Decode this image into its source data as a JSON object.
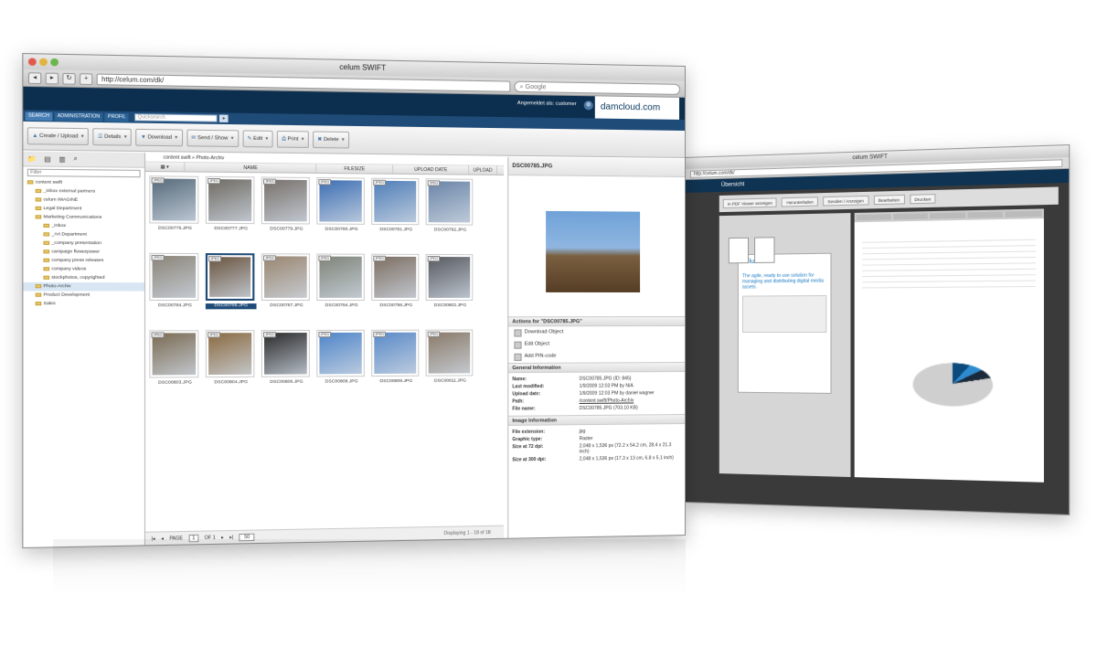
{
  "second_window": {
    "title": "celum SWIFT",
    "url": "http://celum.com/dk/",
    "header": "Übersicht",
    "toolbar": [
      "In PDF Viewer anzeigen",
      "Herunterladen",
      "Senden / Anzeigen",
      "Bearbeiten",
      "Drucken"
    ],
    "brand": "celum.swift",
    "headline": "The agile, ready to use solution for managing and distributing digital media assets."
  },
  "window": {
    "title": "celum SWIFT",
    "url": "http://celum.com/dk/",
    "search_placeholder": "Google"
  },
  "app": {
    "customer": "Angemeldet als: customer",
    "logo": "damcloud.com",
    "nav": [
      "SEARCH",
      "ADMINISTRATION",
      "PROFIL"
    ],
    "quick_search_placeholder": "Quicksearch"
  },
  "toolbar": {
    "create": "Create / Upload",
    "details": "Details",
    "download": "Download",
    "send": "Send / Show",
    "edit": "Edit",
    "print": "Print",
    "delete": "Delete"
  },
  "tree": {
    "filter_placeholder": "Filter",
    "nodes": [
      {
        "label": "content swift",
        "level": 0
      },
      {
        "label": "_inbox external partners",
        "level": 1
      },
      {
        "label": "celum IMAGINE",
        "level": 1
      },
      {
        "label": "Legal Department",
        "level": 1
      },
      {
        "label": "Marketing Communications",
        "level": 1
      },
      {
        "label": "_Inbox",
        "level": 2
      },
      {
        "label": "_Art Department",
        "level": 2
      },
      {
        "label": "_company presentation",
        "level": 2
      },
      {
        "label": "campaign flowerpower",
        "level": 2
      },
      {
        "label": "company press releases",
        "level": 2
      },
      {
        "label": "company videos",
        "level": 2
      },
      {
        "label": "stockphotos, copyrighted",
        "level": 2
      },
      {
        "label": "Photo-Archiv",
        "level": 1,
        "selected": true
      },
      {
        "label": "Product Development",
        "level": 1
      },
      {
        "label": "Sales",
        "level": 1
      }
    ]
  },
  "grid": {
    "breadcrumb": [
      "content swift",
      "Photo-Archiv"
    ],
    "columns": [
      "NAME",
      "FILESIZE",
      "UPLOAD DATE",
      "UPLOAD"
    ],
    "items": [
      {
        "name": "DSC00776.JPG",
        "tag": "JPEG",
        "color": "#566a7a"
      },
      {
        "name": "DSC00777.JPG",
        "tag": "JPEG",
        "color": "#6f6a62"
      },
      {
        "name": "DSC00779.JPG",
        "tag": "JPEG",
        "color": "#77706a"
      },
      {
        "name": "DSC00780.JPG",
        "tag": "JPEG",
        "color": "#3d6fb4"
      },
      {
        "name": "DSC00781.JPG",
        "tag": "JPEG",
        "color": "#4f7eb8"
      },
      {
        "name": "DSC00782.JPG",
        "tag": "JPEG",
        "color": "#6a85a8"
      },
      {
        "name": "DSC00784.JPG",
        "tag": "JPEG",
        "color": "#8a8478"
      },
      {
        "name": "DSC00785.JPG",
        "tag": "JPEG",
        "color": "#6a5540",
        "selected": true
      },
      {
        "name": "DSC00787.JPG",
        "tag": "JPEG",
        "color": "#9a8670"
      },
      {
        "name": "DSC00794.JPG",
        "tag": "JPEG",
        "color": "#7f8478"
      },
      {
        "name": "DSC00798.JPG",
        "tag": "JPEG",
        "color": "#7d6e62"
      },
      {
        "name": "DSC00802.JPG",
        "tag": "JPEG",
        "color": "#585a60"
      },
      {
        "name": "DSC00803.JPG",
        "tag": "JPEG",
        "color": "#7a6a52"
      },
      {
        "name": "DSC00804.JPG",
        "tag": "JPEG",
        "color": "#8a6a40"
      },
      {
        "name": "DSC00806.JPG",
        "tag": "JPEG",
        "color": "#2a2a2a"
      },
      {
        "name": "DSC00808.JPG",
        "tag": "JPEG",
        "color": "#4f86c9"
      },
      {
        "name": "DSC00809.JPG",
        "tag": "JPEG",
        "color": "#5a8ac8"
      },
      {
        "name": "DSC00811.JPG",
        "tag": "JPEG",
        "color": "#8a7a68"
      }
    ]
  },
  "pager": {
    "page_label": "PAGE",
    "page": "1",
    "of": "OF 1",
    "per_page": "50",
    "displaying": "Displaying 1 - 18 of 18"
  },
  "detail": {
    "title": "DSC00785.JPG",
    "actions_title": "Actions for \"DSC00785.JPG\"",
    "actions": [
      "Download Object",
      "Edit Object",
      "Add PIN-code"
    ],
    "general_title": "General Information",
    "general": [
      {
        "k": "Name:",
        "v": "DSC00785.JPG (ID: 845)"
      },
      {
        "k": "Last modified:",
        "v": "1/9/2009 12:03 PM by N/A"
      },
      {
        "k": "Upload date:",
        "v": "1/9/2009 12:03 PM by daniel wagner"
      },
      {
        "k": "Path:",
        "v": "/content swift/Photo-Archiv"
      },
      {
        "k": "File name:",
        "v": "DSC00785.JPG (703.10 KB)"
      }
    ],
    "image_title": "Image Information",
    "image": [
      {
        "k": "File extension:",
        "v": "jpg"
      },
      {
        "k": "Graphic type:",
        "v": "Raster"
      },
      {
        "k": "Size at 72 dpi:",
        "v": "2,048 x 1,536 px (72.2 x 54.2 cm, 28.4 x 21.3 inch)"
      },
      {
        "k": "Size at 300 dpi:",
        "v": "2,048 x 1,536 px (17.3 x 13 cm, 6.8 x 5.1 inch)"
      }
    ]
  },
  "colors": {
    "header": "#0d2f4f",
    "nav": "#1e4b78",
    "accent": "#5b8fc7"
  }
}
